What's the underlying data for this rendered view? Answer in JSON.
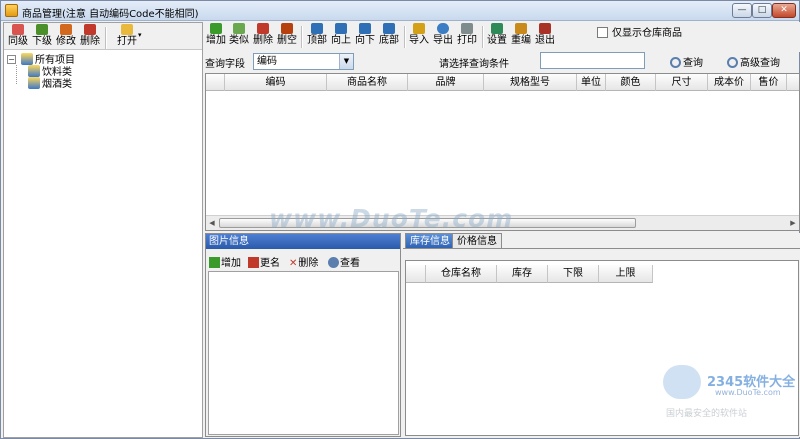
{
  "window": {
    "title": "商品管理(注意 自动编码Code不能相同)",
    "min_label": "—",
    "max_label": "□",
    "close_label": "✕"
  },
  "left_toolbar": {
    "items": [
      {
        "label": "同级",
        "icon": "add-sibling-icon",
        "color": "#d9534f"
      },
      {
        "label": "下级",
        "icon": "add-child-icon",
        "color": "#4a8f2a"
      },
      {
        "label": "修改",
        "icon": "edit-icon",
        "color": "#d2691e"
      },
      {
        "label": "删除",
        "icon": "delete-icon",
        "color": "#c0392b"
      },
      {
        "label": "打开",
        "icon": "folder-open-icon",
        "color": "#e8b93c"
      }
    ]
  },
  "tree": {
    "root": "所有项目",
    "children": [
      "饮料类",
      "烟酒类"
    ]
  },
  "right_toolbar": {
    "items": [
      {
        "label": "增加",
        "icon": "add-icon",
        "color": "#3a9a2a"
      },
      {
        "label": "类似",
        "icon": "copy-similar-icon",
        "color": "#6aa84f"
      },
      {
        "label": "删除",
        "icon": "delete-icon",
        "color": "#c0392b"
      },
      {
        "label": "删空",
        "icon": "clear-all-icon",
        "color": "#b7410e"
      },
      {
        "label": "顶部",
        "icon": "move-top-icon",
        "color": "#2e6fb5"
      },
      {
        "label": "向上",
        "icon": "move-up-icon",
        "color": "#2e6fb5"
      },
      {
        "label": "向下",
        "icon": "move-down-icon",
        "color": "#2e6fb5"
      },
      {
        "label": "底部",
        "icon": "move-bottom-icon",
        "color": "#2e6fb5"
      },
      {
        "label": "导入",
        "icon": "import-icon",
        "color": "#d4a017"
      },
      {
        "label": "导出",
        "icon": "export-icon",
        "color": "#3b7dc4"
      },
      {
        "label": "打印",
        "icon": "print-icon",
        "color": "#7f8c8d"
      },
      {
        "label": "设置",
        "icon": "settings-icon",
        "color": "#2e8b57"
      },
      {
        "label": "重编",
        "icon": "renumber-icon",
        "color": "#c98a1b"
      },
      {
        "label": "退出",
        "icon": "exit-icon",
        "color": "#a93226"
      }
    ],
    "checkbox_label": "仅显示仓库商品"
  },
  "query": {
    "field_label": "查询字段",
    "field_value": "编码",
    "condition_label": "请选择查询条件",
    "condition_value": "",
    "search_label": "查询",
    "advanced_label": "高级查询"
  },
  "goods_grid": {
    "columns": [
      "编码",
      "商品名称",
      "品牌",
      "规格型号",
      "单位",
      "颜色",
      "尺寸",
      "成本价",
      "售价"
    ]
  },
  "picture_panel": {
    "title": "图片信息",
    "add_label": "增加",
    "rename_label": "更名",
    "delete_label": "删除",
    "view_label": "查看"
  },
  "tabs": {
    "stock_label": "库存信息",
    "price_label": "价格信息"
  },
  "stock_grid": {
    "columns": [
      "仓库名称",
      "库存",
      "下限",
      "上限"
    ]
  },
  "watermark": {
    "main": "www.DuoTe.com",
    "logo": "2345软件大全",
    "url": "www.DuoTe.com",
    "sub": "国内最安全的软件站"
  },
  "colors": {
    "title_bar": "#c9d9ee",
    "panel_title": "#2a5aaa",
    "active_tab": "#2f63b2"
  }
}
